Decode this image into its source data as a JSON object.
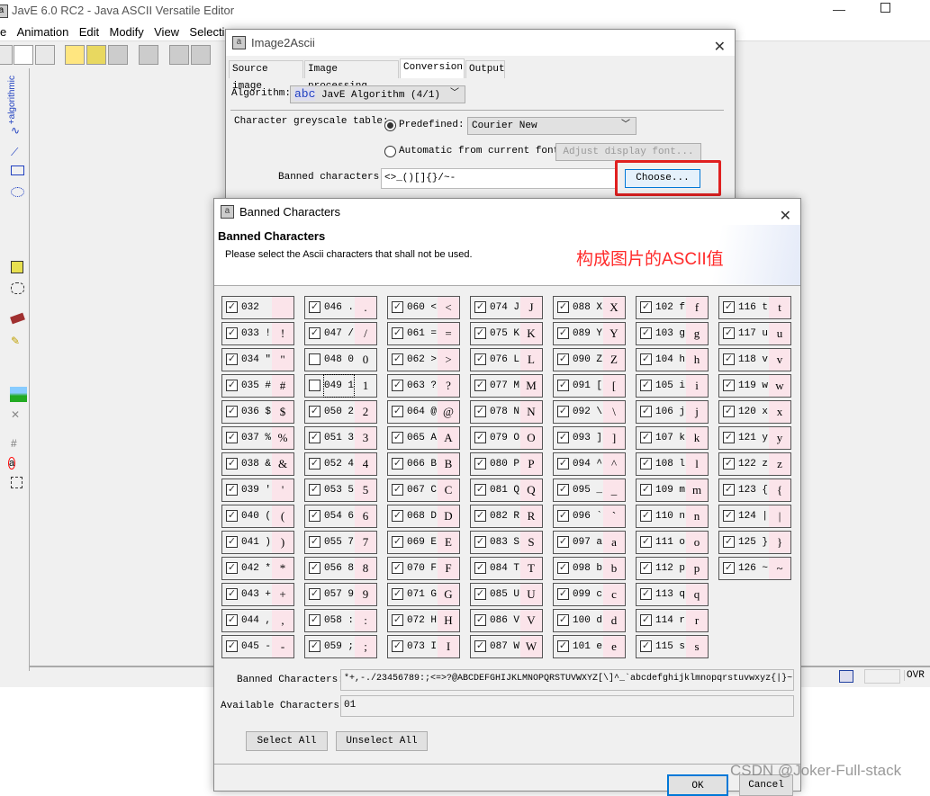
{
  "main": {
    "title": "JavE 6.0 RC2 - Java ASCII Versatile Editor",
    "menu": [
      "e",
      "Animation",
      "Edit",
      "Modify",
      "View",
      "Selection"
    ],
    "palette_label": "+algorithmic",
    "status": {
      "mode": "OVR"
    }
  },
  "image2ascii": {
    "title": "Image2Ascii",
    "tabs": [
      "Source image",
      "Image processing",
      "Conversion",
      "Output"
    ],
    "active_tab": "Conversion",
    "algorithm_label": "Algorithm:",
    "algorithm_icon": "abc",
    "algorithm_value": "JavE Algorithm (4/1)",
    "greyscale_label": "Character greyscale table:",
    "predefined_label": "Predefined:",
    "predefined_value": "Courier New",
    "predefined_selected": true,
    "automatic_label": "Automatic from current font",
    "adjust_button": "Adjust display font...",
    "banned_label": "Banned characters:",
    "banned_value": "<>_()[]{}/~-",
    "choose_button": "Choose..."
  },
  "annotation": {
    "text": "构成图片的ASCII值",
    "color": "#ff2a2a"
  },
  "banned": {
    "title": "Banned Characters",
    "heading": "Banned Characters",
    "subtitle": "Please select the Ascii characters that shall not be used.",
    "unchecked_codes": [
      48,
      49
    ],
    "focused_code": 49,
    "banned_field_label": "Banned Characters:",
    "banned_field_value": "*+,-./23456789:;<=>?@ABCDEFGHIJKLMNOPQRSTUVWXYZ[\\]^_`abcdefghijklmnopqrstuvwxyz{|}~",
    "available_label": "Available Characters:",
    "available_value": "01",
    "select_all": "Select All",
    "unselect_all": "Unselect All",
    "ok": "OK",
    "cancel": "Cancel"
  },
  "watermark": "CSDN @Joker-Full-stack",
  "colors": {
    "highlight_box": "#e02020",
    "preview_bg": "#fbe4ea",
    "choose_focus": "#0078d7"
  }
}
